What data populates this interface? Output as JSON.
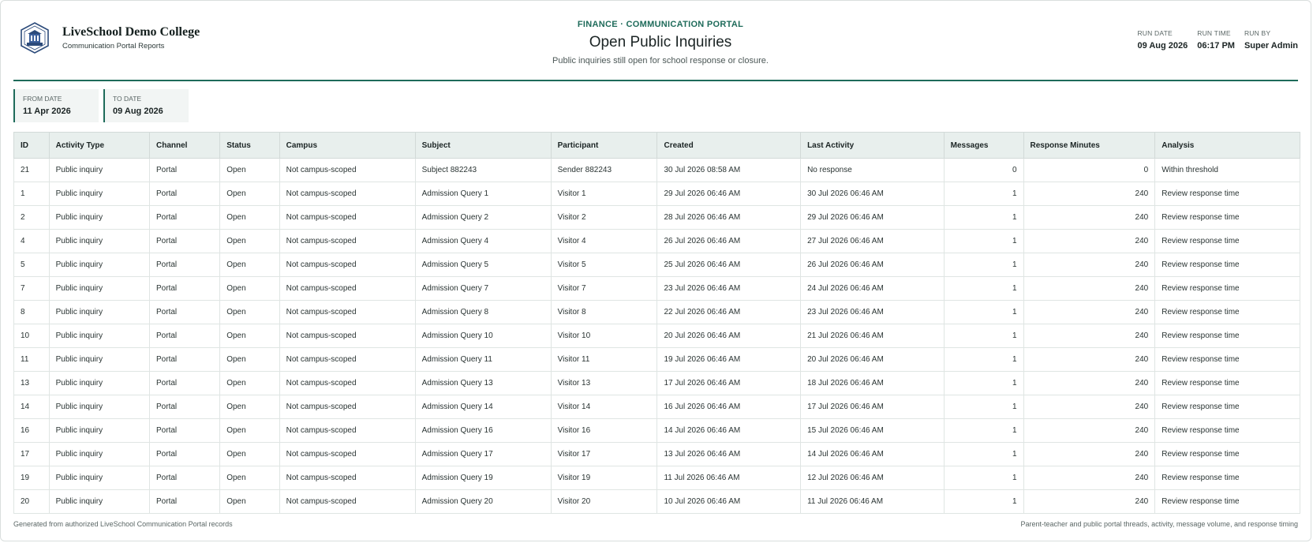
{
  "brand": {
    "name": "LiveSchool Demo College",
    "subtitle": "Communication Portal Reports"
  },
  "report": {
    "eyebrow": "FINANCE · COMMUNICATION PORTAL",
    "title": "Open Public Inquiries",
    "subtitle": "Public inquiries still open for school response or closure."
  },
  "meta": [
    {
      "label": "RUN DATE",
      "value": "09 Aug 2026"
    },
    {
      "label": "RUN TIME",
      "value": "06:17 PM"
    },
    {
      "label": "RUN BY",
      "value": "Super Admin"
    }
  ],
  "filters": [
    {
      "label": "FROM DATE",
      "value": "11 Apr 2026"
    },
    {
      "label": "TO DATE",
      "value": "09 Aug 2026"
    }
  ],
  "table": {
    "columns": [
      "ID",
      "Activity Type",
      "Channel",
      "Status",
      "Campus",
      "Subject",
      "Participant",
      "Created",
      "Last Activity",
      "Messages",
      "Response Minutes",
      "Analysis"
    ],
    "rows": [
      [
        "21",
        "Public inquiry",
        "Portal",
        "Open",
        "Not campus-scoped",
        "Subject 882243",
        "Sender 882243",
        "30 Jul 2026 08:58 AM",
        "No response",
        "0",
        "0",
        "Within threshold"
      ],
      [
        "1",
        "Public inquiry",
        "Portal",
        "Open",
        "Not campus-scoped",
        "Admission Query 1",
        "Visitor 1",
        "29 Jul 2026 06:46 AM",
        "30 Jul 2026 06:46 AM",
        "1",
        "240",
        "Review response time"
      ],
      [
        "2",
        "Public inquiry",
        "Portal",
        "Open",
        "Not campus-scoped",
        "Admission Query 2",
        "Visitor 2",
        "28 Jul 2026 06:46 AM",
        "29 Jul 2026 06:46 AM",
        "1",
        "240",
        "Review response time"
      ],
      [
        "4",
        "Public inquiry",
        "Portal",
        "Open",
        "Not campus-scoped",
        "Admission Query 4",
        "Visitor 4",
        "26 Jul 2026 06:46 AM",
        "27 Jul 2026 06:46 AM",
        "1",
        "240",
        "Review response time"
      ],
      [
        "5",
        "Public inquiry",
        "Portal",
        "Open",
        "Not campus-scoped",
        "Admission Query 5",
        "Visitor 5",
        "25 Jul 2026 06:46 AM",
        "26 Jul 2026 06:46 AM",
        "1",
        "240",
        "Review response time"
      ],
      [
        "7",
        "Public inquiry",
        "Portal",
        "Open",
        "Not campus-scoped",
        "Admission Query 7",
        "Visitor 7",
        "23 Jul 2026 06:46 AM",
        "24 Jul 2026 06:46 AM",
        "1",
        "240",
        "Review response time"
      ],
      [
        "8",
        "Public inquiry",
        "Portal",
        "Open",
        "Not campus-scoped",
        "Admission Query 8",
        "Visitor 8",
        "22 Jul 2026 06:46 AM",
        "23 Jul 2026 06:46 AM",
        "1",
        "240",
        "Review response time"
      ],
      [
        "10",
        "Public inquiry",
        "Portal",
        "Open",
        "Not campus-scoped",
        "Admission Query 10",
        "Visitor 10",
        "20 Jul 2026 06:46 AM",
        "21 Jul 2026 06:46 AM",
        "1",
        "240",
        "Review response time"
      ],
      [
        "11",
        "Public inquiry",
        "Portal",
        "Open",
        "Not campus-scoped",
        "Admission Query 11",
        "Visitor 11",
        "19 Jul 2026 06:46 AM",
        "20 Jul 2026 06:46 AM",
        "1",
        "240",
        "Review response time"
      ],
      [
        "13",
        "Public inquiry",
        "Portal",
        "Open",
        "Not campus-scoped",
        "Admission Query 13",
        "Visitor 13",
        "17 Jul 2026 06:46 AM",
        "18 Jul 2026 06:46 AM",
        "1",
        "240",
        "Review response time"
      ],
      [
        "14",
        "Public inquiry",
        "Portal",
        "Open",
        "Not campus-scoped",
        "Admission Query 14",
        "Visitor 14",
        "16 Jul 2026 06:46 AM",
        "17 Jul 2026 06:46 AM",
        "1",
        "240",
        "Review response time"
      ],
      [
        "16",
        "Public inquiry",
        "Portal",
        "Open",
        "Not campus-scoped",
        "Admission Query 16",
        "Visitor 16",
        "14 Jul 2026 06:46 AM",
        "15 Jul 2026 06:46 AM",
        "1",
        "240",
        "Review response time"
      ],
      [
        "17",
        "Public inquiry",
        "Portal",
        "Open",
        "Not campus-scoped",
        "Admission Query 17",
        "Visitor 17",
        "13 Jul 2026 06:46 AM",
        "14 Jul 2026 06:46 AM",
        "1",
        "240",
        "Review response time"
      ],
      [
        "19",
        "Public inquiry",
        "Portal",
        "Open",
        "Not campus-scoped",
        "Admission Query 19",
        "Visitor 19",
        "11 Jul 2026 06:46 AM",
        "12 Jul 2026 06:46 AM",
        "1",
        "240",
        "Review response time"
      ],
      [
        "20",
        "Public inquiry",
        "Portal",
        "Open",
        "Not campus-scoped",
        "Admission Query 20",
        "Visitor 20",
        "10 Jul 2026 06:46 AM",
        "11 Jul 2026 06:46 AM",
        "1",
        "240",
        "Review response time"
      ]
    ]
  },
  "footer": {
    "left": "Generated from authorized LiveSchool Communication Portal records",
    "right": "Parent-teacher and public portal threads, activity, message volume, and response timing"
  },
  "colors": {
    "accent": "#1e6b5a",
    "header_bg": "#e8efed"
  },
  "icons": {
    "logo": "school-crest-icon"
  }
}
